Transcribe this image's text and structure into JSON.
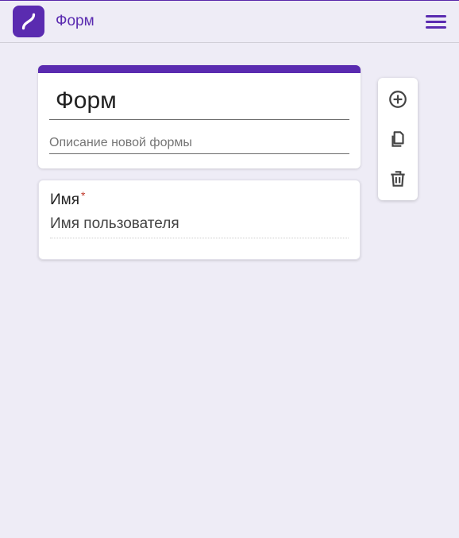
{
  "header": {
    "app_title": "Форм"
  },
  "form": {
    "title": "Форм",
    "description_placeholder": "Описание новой формы",
    "questions": [
      {
        "label": "Имя",
        "required": true,
        "placeholder": "Имя пользователя"
      }
    ]
  },
  "tools": {
    "add": "add-icon",
    "duplicate": "duplicate-icon",
    "delete": "trash-icon"
  }
}
